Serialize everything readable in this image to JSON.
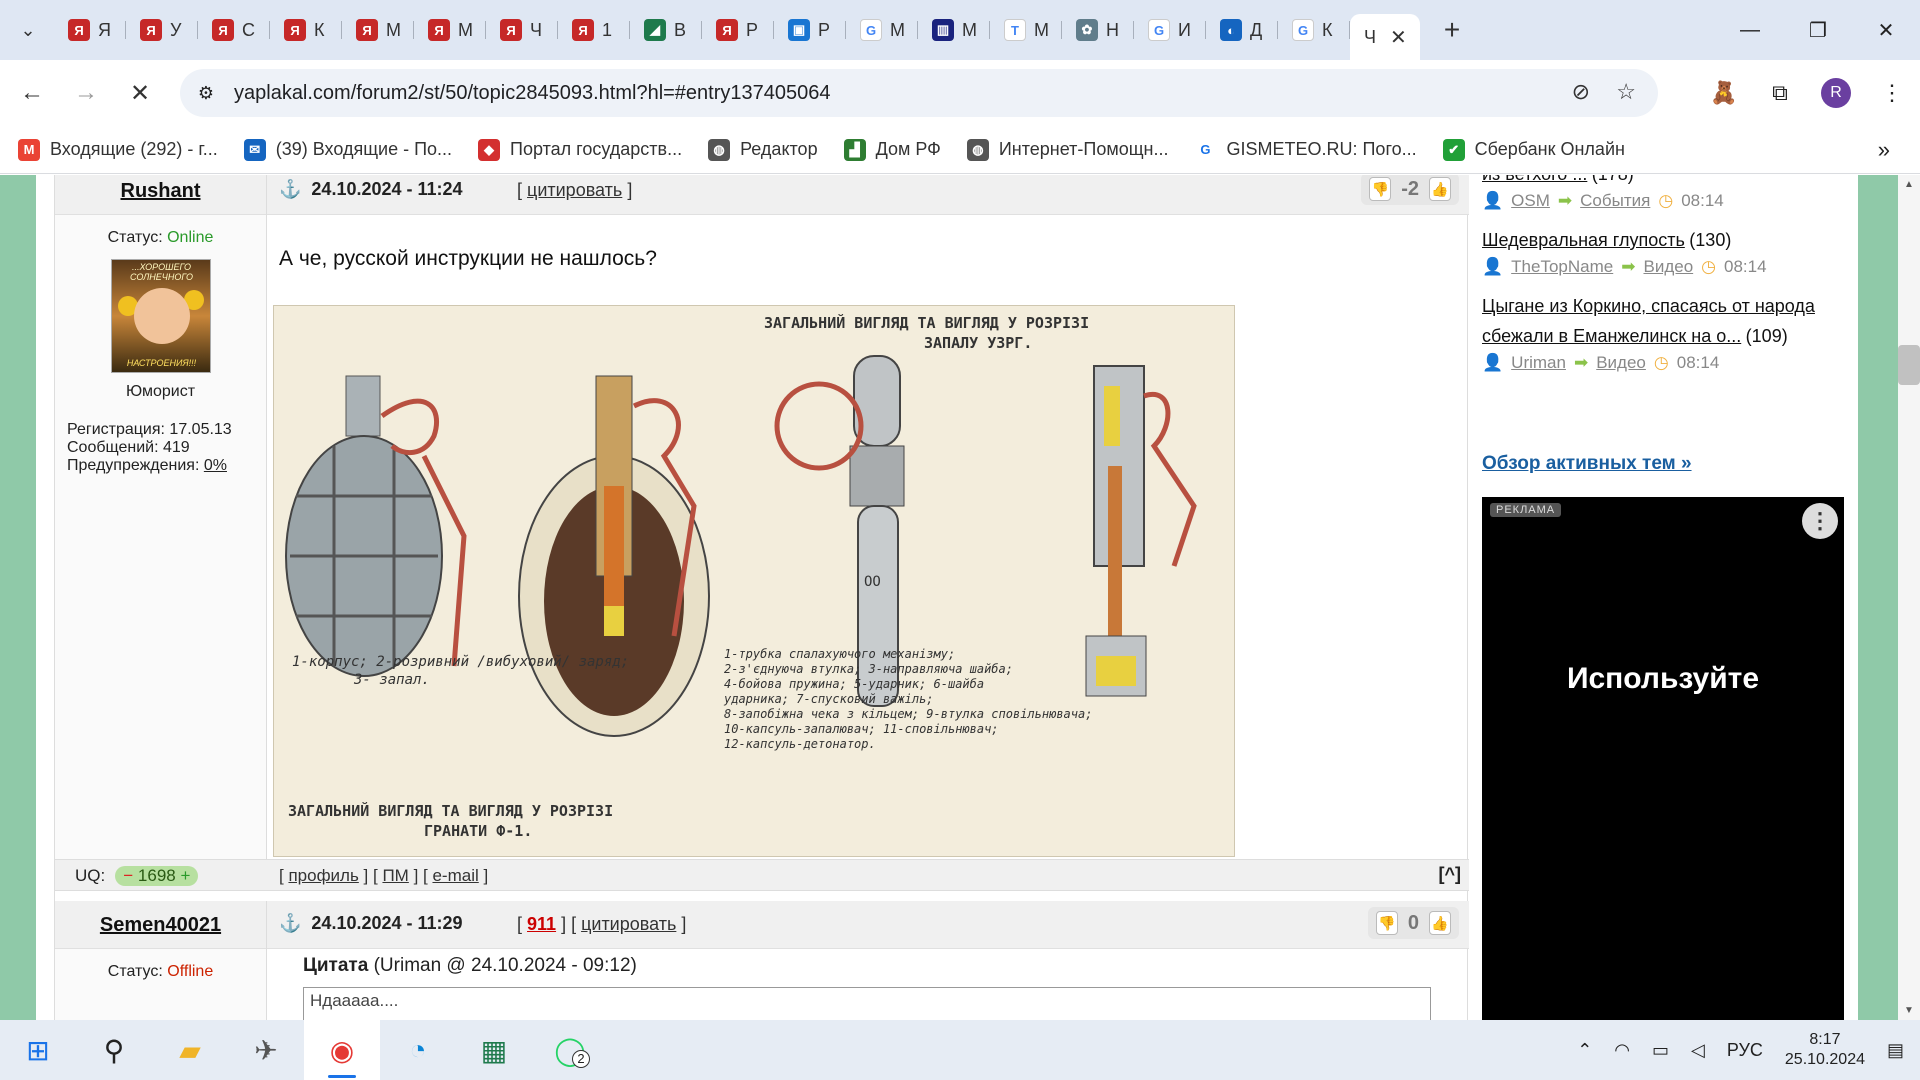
{
  "tabs": [
    {
      "label": "Я",
      "color": "#c62828",
      "glyph": "Я"
    },
    {
      "label": "У",
      "color": "#c62828",
      "glyph": "Я"
    },
    {
      "label": "С",
      "color": "#c62828",
      "glyph": "Я"
    },
    {
      "label": "К",
      "color": "#c62828",
      "glyph": "Я"
    },
    {
      "label": "М",
      "color": "#c62828",
      "glyph": "Я"
    },
    {
      "label": "М",
      "color": "#c62828",
      "glyph": "Я"
    },
    {
      "label": "Ч",
      "color": "#c62828",
      "glyph": "Я"
    },
    {
      "label": "1",
      "color": "#c62828",
      "glyph": "Я"
    },
    {
      "label": "В",
      "color": "#1e7a4c",
      "glyph": "◢"
    },
    {
      "label": "Р",
      "color": "#c62828",
      "glyph": "Я"
    },
    {
      "label": "Р",
      "color": "#1976d2",
      "glyph": "▣"
    },
    {
      "label": "М",
      "color": "#ffffff",
      "glyph": "G"
    },
    {
      "label": "М",
      "color": "#1a237e",
      "glyph": "▥"
    },
    {
      "label": "М",
      "color": "#ffffff",
      "glyph": "T"
    },
    {
      "label": "Н",
      "color": "#607d8b",
      "glyph": "✿"
    },
    {
      "label": "И",
      "color": "#ffffff",
      "glyph": "G"
    },
    {
      "label": "Д",
      "color": "#1565c0",
      "glyph": "◐"
    },
    {
      "label": "К",
      "color": "#ffffff",
      "glyph": "G"
    }
  ],
  "active_tab": {
    "label": "Ч",
    "close": "✕"
  },
  "window_controls": {
    "minimize": "—",
    "maximize": "❐",
    "close": "✕"
  },
  "new_tab": "+",
  "url": "yaplakal.com/forum2/st/50/topic2845093.html?hl=#entry137405064",
  "profile_initial": "R",
  "bookmarks": [
    {
      "label": "Входящие (292) - г...",
      "color": "#ea4335",
      "glyph": "M"
    },
    {
      "label": "(39) Входящие - По...",
      "color": "#1565c0",
      "glyph": "✉"
    },
    {
      "label": "Портал государств...",
      "color": "#d32f2f",
      "glyph": "◆"
    },
    {
      "label": "Редактор",
      "color": "#555555",
      "glyph": "◍"
    },
    {
      "label": "Дом РФ",
      "color": "#2e7d32",
      "glyph": "▟"
    },
    {
      "label": "Интернет-Помощн...",
      "color": "#555555",
      "glyph": "◍"
    },
    {
      "label": "GISMETEO.RU: Пого...",
      "color": "#ffffff",
      "glyph": "G"
    },
    {
      "label": "Сбербанк Онлайн",
      "color": "#21a038",
      "glyph": "✔"
    }
  ],
  "post1": {
    "author": "Rushant",
    "date": "24.10.2024 - 11:24",
    "quote_link": "цитировать",
    "rating": "-2",
    "status_label": "Статус:",
    "status": "Online",
    "avatar_caption_top": "...ХОРОШЕГО СОЛНЕЧНОГО",
    "avatar_caption_bottom": "НАСТРОЕНИЯ!!!",
    "rank": "Юморист",
    "registration": "Регистрация: 17.05.13",
    "messages": "Сообщений: 419",
    "warnings_label": "Предупреждения:",
    "warnings": "0%",
    "text": "А че, русской инструкции не нашлось?",
    "uq_label": "UQ:",
    "uq_value": "1698",
    "profile_link": "профиль",
    "pm_link": "ПМ",
    "email_link": "e-mail",
    "to_top": "[^]"
  },
  "diagram": {
    "title_top": "ЗАГАЛЬНИЙ ВИГЛЯД ТА ВИГЛЯД У РОЗРІЗІ",
    "title_top2": "ЗАПАЛУ УЗРГ.",
    "title_bottom": "ЗАГАЛЬНИЙ ВИГЛЯД ТА ВИГЛЯД У РОЗРІЗІ",
    "title_bottom2": "ГРАНАТИ Ф-1.",
    "legend_left": "1-корпус;  2-розривний /вибуховий/ заряд;",
    "legend_left2": "3- запал.",
    "legend_right": [
      "1-трубка спалахуючого механізму;",
      "2-з'єднуюча втулка;  3-направляюча шайба;",
      "4-бойова пружина; 5-ударник; 6-шайба",
      "ударника; 7-спусковий важіль;",
      "8-запобіжна чека з кільцем; 9-втулка сповільнювача;",
      "10-капсуль-запалювач; 11-сповільнювач;",
      "12-капсуль-детонатор."
    ]
  },
  "post2": {
    "author": "Semen40021",
    "date": "24.10.2024 - 11:29",
    "red_link": "911",
    "quote_link": "цитировать",
    "rating": "0",
    "status_label": "Статус:",
    "status": "Offline",
    "quote_title": "Цитата",
    "quote_meta": "(Uriman @ 24.10.2024 - 09:12)",
    "quote_text": "Ндааааа...."
  },
  "sidebar": {
    "items": [
      {
        "title": "из ветхого ...",
        "count": "(178)",
        "user": "OSM",
        "section": "События",
        "time": "08:14"
      },
      {
        "title": "Шедевральная глупость",
        "count": "(130)",
        "user": "TheTopName",
        "section": "Видео",
        "time": "08:14"
      },
      {
        "title": "Цыгане из Коркино, спасаясь от народа сбежали в Еманжелинск на о...",
        "count": "(109)",
        "user": "Uriman",
        "section": "Видео",
        "time": "08:14"
      }
    ],
    "overview": "Обзор активных тем »",
    "ad_tag": "РЕКЛАМА",
    "ad_text": "Используйте"
  },
  "taskbar": {
    "lang": "РУС",
    "time": "8:17",
    "date": "25.10.2024",
    "whatsapp_badge": "2"
  }
}
